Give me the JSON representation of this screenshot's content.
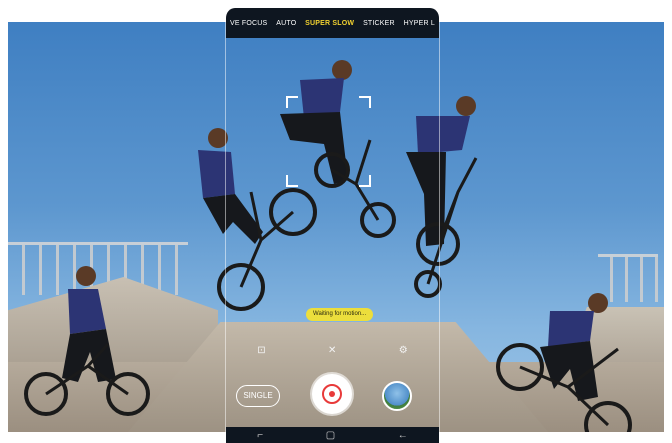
{
  "camera": {
    "modes": [
      {
        "label": "VE FOCUS",
        "active": false
      },
      {
        "label": "AUTO",
        "active": false
      },
      {
        "label": "SUPER SLOW",
        "active": true
      },
      {
        "label": "STICKER",
        "active": false
      },
      {
        "label": "HYPER L",
        "active": false
      }
    ],
    "status_message": "Waiting for motion...",
    "capture_mode_label": "SINGLE",
    "accent_color": "#f2d230",
    "controls": {
      "left_icon": "motion-detect-icon",
      "center_icon": "flash-off-icon",
      "right_icon": "settings-icon"
    },
    "navigation": {
      "recent_icon": "recent-apps-icon",
      "home_icon": "home-icon",
      "back_icon": "back-icon"
    }
  }
}
